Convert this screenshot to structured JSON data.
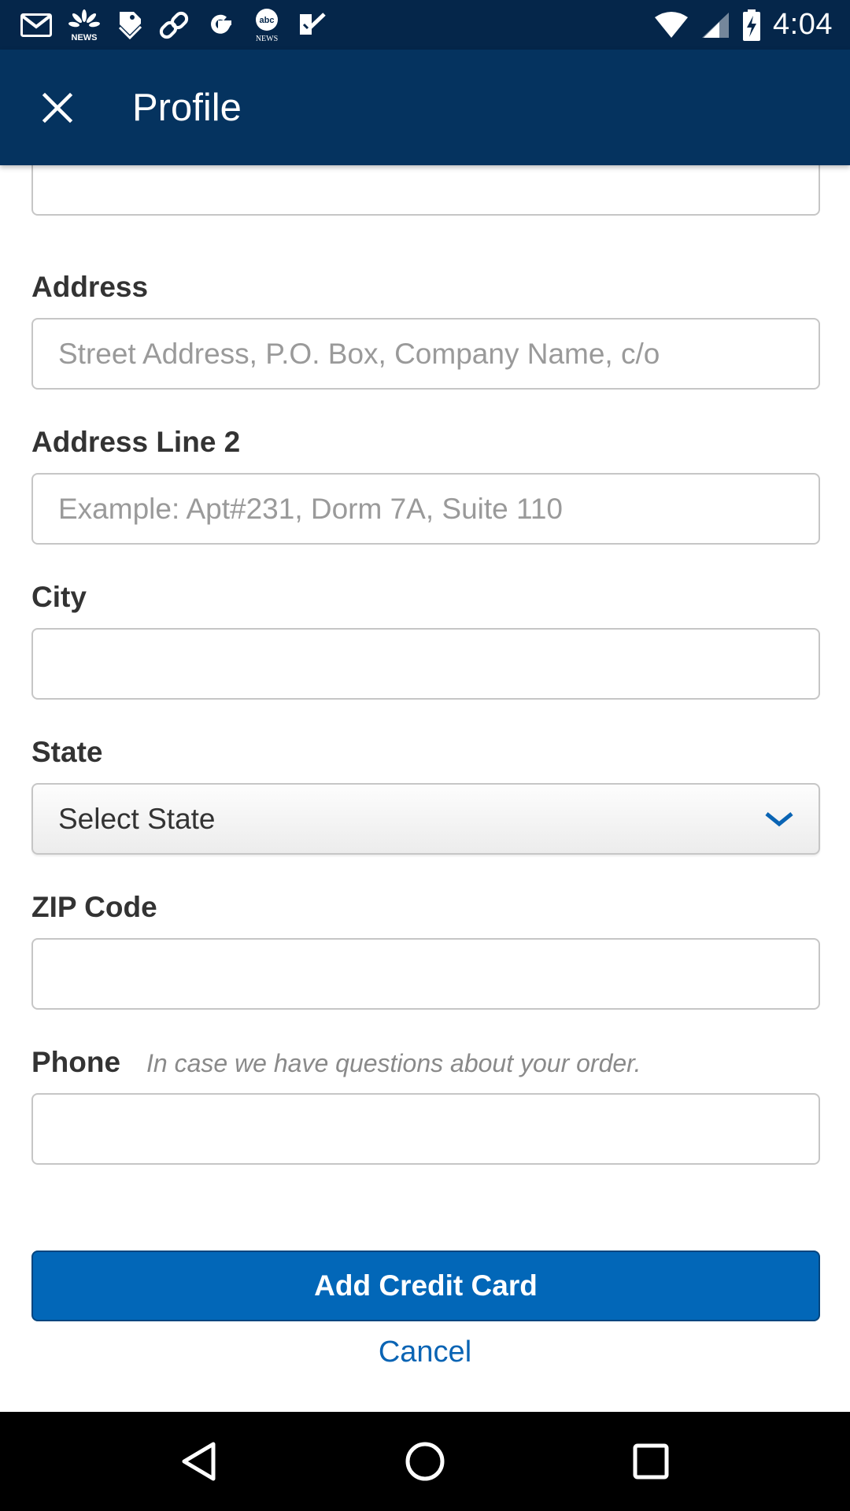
{
  "status_bar": {
    "time": "4:04",
    "notification_icons": [
      "gmail-icon",
      "nbc-news-icon",
      "tag-icon",
      "link-icon",
      "google-icon",
      "abc-news-icon",
      "checkmark-tag-icon"
    ],
    "system_icons": [
      "wifi-icon",
      "cell-signal-icon",
      "battery-charging-icon"
    ]
  },
  "app_bar": {
    "title": "Profile",
    "close_icon": "close-icon",
    "background": "#05335f"
  },
  "form": {
    "top_field": {
      "value": ""
    },
    "address": {
      "label": "Address",
      "placeholder": "Street Address, P.O. Box, Company Name, c/o",
      "value": ""
    },
    "address2": {
      "label": "Address Line 2",
      "placeholder": "Example: Apt#231, Dorm 7A, Suite 110",
      "value": ""
    },
    "city": {
      "label": "City",
      "value": ""
    },
    "state": {
      "label": "State",
      "selected": "Select State"
    },
    "zip": {
      "label": "ZIP Code",
      "value": ""
    },
    "phone": {
      "label": "Phone",
      "hint": "In case we have questions about your order.",
      "value": ""
    }
  },
  "actions": {
    "primary_label": "Add Credit Card",
    "cancel_label": "Cancel",
    "primary_color": "#0267b8",
    "link_color": "#0a64b4"
  },
  "nav_bar": {
    "icons": [
      "back-icon",
      "home-icon",
      "recents-icon"
    ]
  }
}
